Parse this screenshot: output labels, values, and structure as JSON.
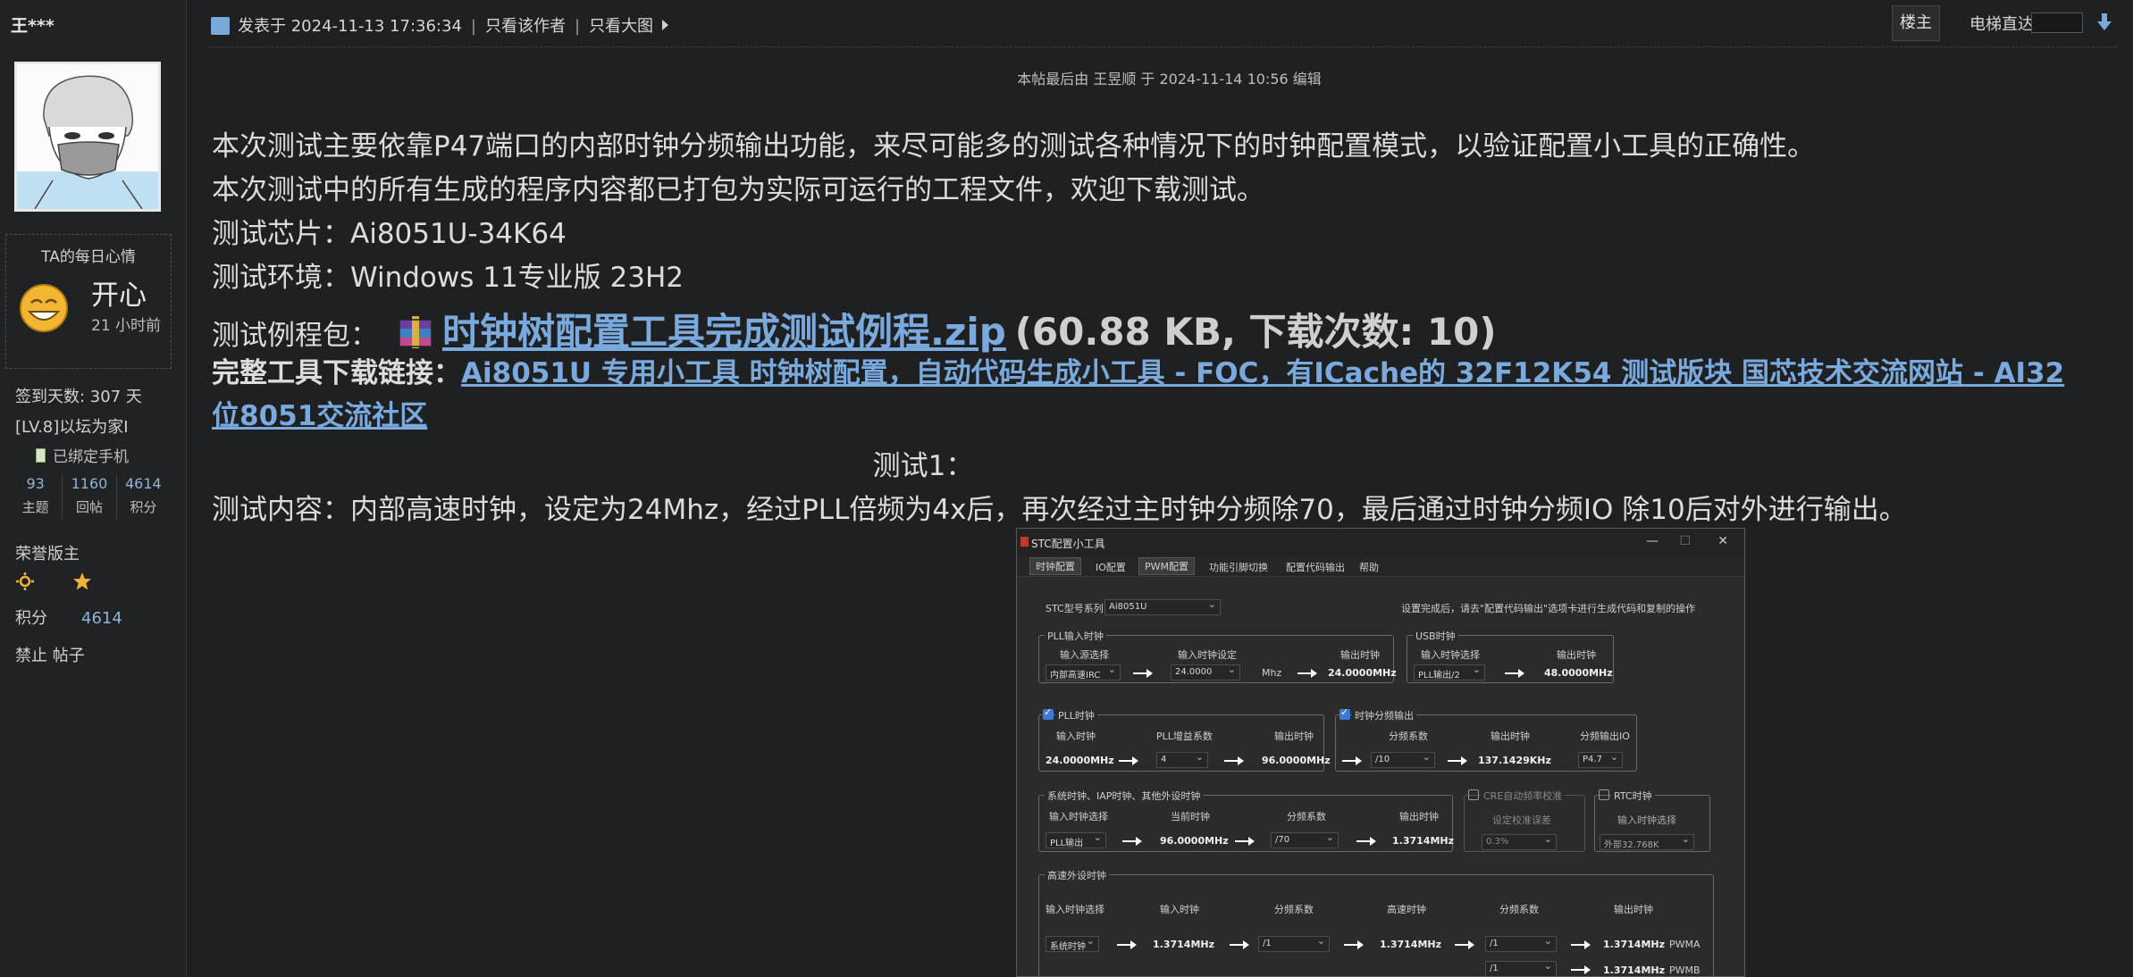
{
  "sidebar": {
    "username": "王***",
    "mood_title": "TA的每日心情",
    "mood_word": "开心",
    "mood_time": "21 小时前",
    "checkin": "签到天数: 307 天",
    "level": "[LV.8]以坛为家I",
    "phone": "已绑定手机",
    "stats": [
      {
        "num": "93",
        "label": "主题"
      },
      {
        "num": "1160",
        "label": "回帖"
      },
      {
        "num": "4614",
        "label": "积分"
      }
    ],
    "honor": "荣誉版主",
    "score_label": "积分",
    "score_value": "4614",
    "ban": "禁止 帖子"
  },
  "topbar": {
    "posted": "发表于 2024-11-13 17:36:34",
    "only_author": "只看该作者",
    "only_bigimg": "只看大图",
    "floor": "楼主",
    "jump_label": "电梯直达"
  },
  "post": {
    "edit_note": "本帖最后由 王昱顺 于 2024-11-14 10:56 编辑",
    "line1": "本次测试主要依靠P47端口的内部时钟分频输出功能，来尽可能多的测试各种情况下的时钟配置模式，以验证配置小工具的正确性。",
    "line2": "本次测试中的所有生成的程序内容都已打包为实际可运行的工程文件，欢迎下载测试。",
    "chip": "测试芯片：Ai8051U-34K64",
    "env": "测试环境：Windows 11专业版 23H2",
    "example_label": "测试例程包：",
    "zip_name": "时钟树配置工具完成测试例程.zip",
    "zip_meta": "(60.88 KB, 下载次数: 10)",
    "tool_label": "完整工具下载链接：",
    "tool_link_1": "Ai8051U 专用小工具 时钟树配置，自动代码生成小工具 - FOC，有ICache的 32F12K54 测试版块 国芯技术交流网站 - AI32",
    "tool_link_2": "位8051交流社区",
    "test1": "测试1：",
    "test_content": "测试内容：内部高速时钟，设定为24Mhz，经过PLL倍频为4x后，再次经过主时钟分频除70，最后通过时钟分频IO 除10后对外进行输出。"
  },
  "tool": {
    "title": "STC配置小工具",
    "menus": [
      "时钟配置",
      "IO配置",
      "PWM配置",
      "功能引脚切换",
      "配置代码输出",
      "帮助"
    ],
    "model_label": "STC型号系列",
    "model_value": "Ai8051U",
    "hint": "设置完成后，请去\"配置代码输出\"选项卡进行生成代码和复制的操作",
    "pll_in": {
      "title": "PLL输入时钟",
      "src_label": "输入源选择",
      "src_value": "内部高速IRC",
      "set_label": "输入时钟设定",
      "set_value": "24.0000",
      "unit": "Mhz",
      "out_label": "输出时钟",
      "out_value": "24.0000MHz"
    },
    "usb": {
      "title": "USB时钟",
      "src_label": "输入时钟选择",
      "src_value": "PLL输出/2",
      "out_label": "输出时钟",
      "out_value": "48.0000MHz"
    },
    "pll": {
      "title": "PLL时钟",
      "in_label": "输入时钟",
      "in_value": "24.0000MHz",
      "gain_label": "PLL增益系数",
      "gain_value": "4",
      "out_label": "输出时钟",
      "out_value": "96.0000MHz"
    },
    "divout": {
      "title": "时钟分频输出",
      "div_label": "分频系数",
      "div_value": "/10",
      "out_label": "输出时钟",
      "out_value": "137.1429KHz",
      "io_label": "分频输出IO",
      "io_value": "P4.7"
    },
    "sys": {
      "title": "系统时钟、IAP时钟、其他外设时钟",
      "src_label": "输入时钟选择",
      "src_value": "PLL输出",
      "cur_label": "当前时钟",
      "cur_value": "96.0000MHz",
      "div_label": "分频系数",
      "div_value": "/70",
      "out_label": "输出时钟",
      "out_value": "1.3714MHz"
    },
    "cre": {
      "title": "CRE自动频率校准",
      "err_label": "设定校准误差",
      "err_value": "0.3%"
    },
    "rtc": {
      "title": "RTC时钟",
      "src_label": "输入时钟选择",
      "src_value": "外部32.768K"
    },
    "hs": {
      "title": "高速外设时钟",
      "src_label": "输入时钟选择",
      "src_value": "系统时钟",
      "in_label": "输入时钟",
      "in_value": "1.3714MHz",
      "div1_label": "分频系数",
      "div1_value": "/1",
      "hs_label": "高速时钟",
      "hs_value": "1.3714MHz",
      "div2_label": "分频系数",
      "div2_value": "/1",
      "out_label": "输出时钟",
      "out_value_a": "1.3714MHz",
      "out_name_a": "PWMA",
      "div3_value": "/1",
      "out_value_b": "1.3714MHz",
      "out_name_b": "PWMB"
    }
  },
  "colors": {
    "link": "#7aa9de",
    "background": "#1f2021",
    "text": "#dcdcdc"
  }
}
